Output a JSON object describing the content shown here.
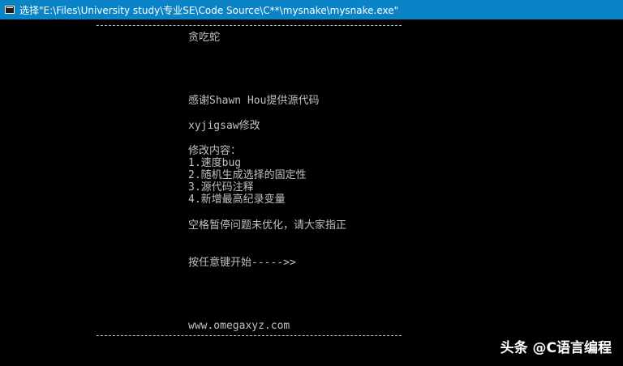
{
  "window": {
    "title": "选择\"E:\\Files\\University study\\专业SE\\Code Source\\C**\\mysnake\\mysnake.exe\"",
    "titlebar_color": "#0a84c6",
    "app_icon": "console-app-icon"
  },
  "console": {
    "text_color": "#c0c0c0",
    "background": "#000000",
    "game_title": "贪吃蛇",
    "thanks": "感谢Shawn Hou提供源代码",
    "modifier": "xyjigsaw修改",
    "changes_heading": "修改内容：",
    "changes": [
      "1.速度bug",
      "2.随机生成选择的固定性",
      "3.源代码注释",
      "4.新增最高纪录变量"
    ],
    "notice": "空格暂停问题未优化，请大家指正",
    "prompt": "按任意键开始----->>",
    "website": "www.omegaxyz.com"
  },
  "watermark": {
    "text": "头条 @C语言编程"
  }
}
